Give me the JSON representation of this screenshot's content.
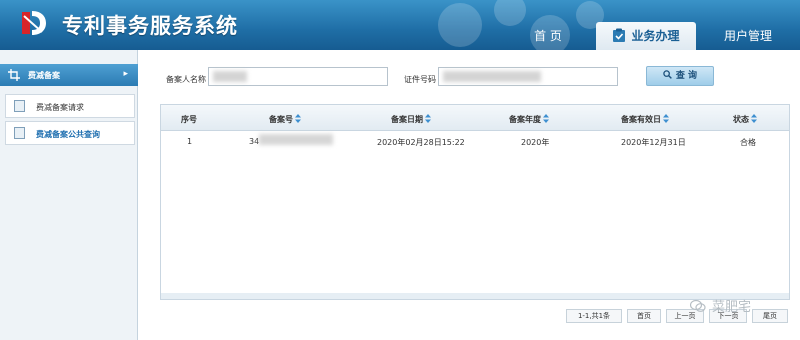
{
  "header": {
    "app_title": "专利事务服务系统",
    "tabs": [
      {
        "label": "首 页"
      },
      {
        "label": "业务办理"
      },
      {
        "label": "用户管理"
      }
    ]
  },
  "sidebar": {
    "section_title": "费减备案",
    "items": [
      {
        "label": "费减备案请求"
      },
      {
        "label": "费减备案公共查询"
      }
    ]
  },
  "search": {
    "name_label": "备案人名称",
    "id_label": "证件号码",
    "button_label": "查 询"
  },
  "table": {
    "columns": [
      "序号",
      "备案号",
      "备案日期",
      "备案年度",
      "备案有效日",
      "状态"
    ],
    "rows": [
      [
        "1",
        "34",
        "2020年02月28日15:22",
        "2020年",
        "2020年12月31日",
        "合格"
      ]
    ]
  },
  "pager": {
    "summary": "1-1,共1条",
    "first": "首页",
    "prev": "上一页",
    "next": "下一页",
    "last": "尾页"
  },
  "watermark": "菜肥宅",
  "colors": {
    "header_blue": "#1f6ea6",
    "accent_blue": "#2b7bb3",
    "link_blue": "#1f6fb0"
  }
}
